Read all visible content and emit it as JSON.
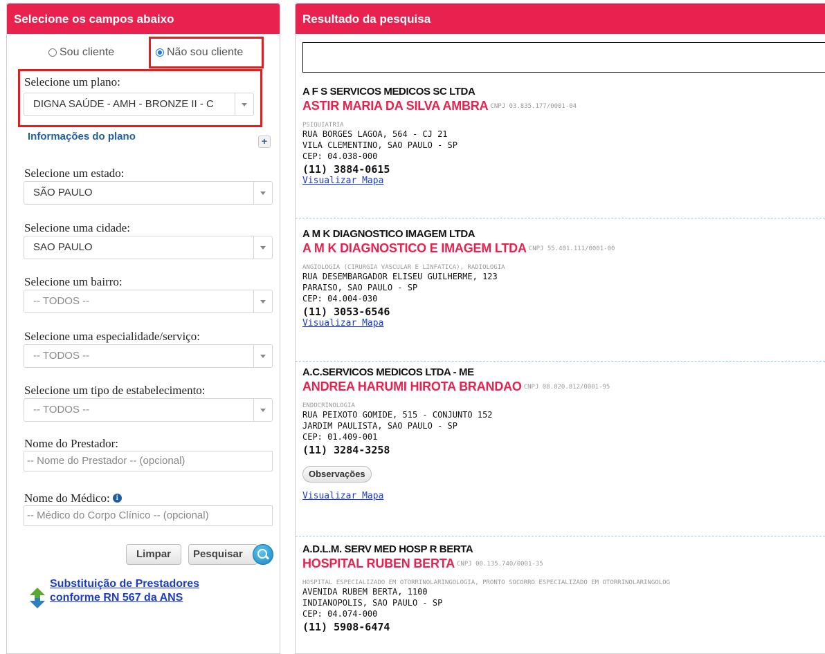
{
  "left_panel": {
    "title": "Selecione os campos abaixo",
    "radio_client": "Sou cliente",
    "radio_not_client": "Não sou cliente",
    "plan_label": "Selecione um plano:",
    "plan_value": "DIGNA SAÚDE - AMH - BRONZE II - C",
    "plan_info_link": "Informações do plano",
    "state_label": "Selecione um estado:",
    "state_value": "SÃO PAULO",
    "city_label": "Selecione uma cidade:",
    "city_value": "SAO PAULO",
    "district_label": "Selecione um bairro:",
    "district_value": "-- TODOS --",
    "specialty_label": "Selecione uma especialidade/serviço:",
    "specialty_value": "-- TODOS --",
    "estab_label": "Selecione um tipo de estabelecimento:",
    "estab_value": "-- TODOS --",
    "provider_label": "Nome do Prestador:",
    "provider_placeholder": "-- Nome do Prestador -- (opcional)",
    "doctor_label": "Nome do Médico:",
    "doctor_placeholder": "-- Médico do Corpo Clínico -- (opcional)",
    "clear_button": "Limpar",
    "search_button": "Pesquisar",
    "subst_link_line1": "Substituição de Prestadores",
    "subst_link_line2": "conforme RN 567 da ANS"
  },
  "right_panel": {
    "title": "Resultado da pesquisa",
    "results": [
      {
        "name": "A F S SERVICOS MEDICOS SC LTDA",
        "subname": "ASTIR MARIA DA SILVA AMBRA",
        "cnpj": "CNPJ 03.835.177/0001-04",
        "specialty": "PSIQUIATRIA",
        "address1": "RUA BORGES LAGOA, 564 - CJ 21",
        "address2": "VILA CLEMENTINO, SAO PAULO - SP",
        "cep": "CEP: 04.038-000",
        "phone": "(11) 3884-0615",
        "map_link": "Visualizar Mapa"
      },
      {
        "name": "A M K DIAGNOSTICO IMAGEM LTDA",
        "subname": "A M K DIAGNOSTICO E IMAGEM LTDA",
        "cnpj": "CNPJ 55.401.111/0001-00",
        "specialty": "ANGIOLOGIA (CIRURGIA VASCULAR E LINFATICA), RADIOLOGIA",
        "address1": "RUA DESEMBARGADOR ELISEU GUILHERME, 123",
        "address2": "PARAISO, SAO PAULO - SP",
        "cep": "CEP: 04.004-030",
        "phone": "(11) 3053-6546",
        "map_link": "Visualizar Mapa"
      },
      {
        "name": "A.C.SERVICOS MEDICOS LTDA - ME",
        "subname": "ANDREA HARUMI HIROTA BRANDAO",
        "cnpj": "CNPJ 08.820.812/0001-95",
        "specialty": "ENDOCRINOLOGIA",
        "address1": "RUA PEIXOTO GOMIDE, 515 - CONJUNTO 152",
        "address2": "JARDIM PAULISTA, SAO PAULO - SP",
        "cep": "CEP: 01.409-001",
        "phone": "(11) 3284-3258",
        "obs_button": "Observações",
        "map_link": "Visualizar Mapa"
      },
      {
        "name": "A.D.L.M. SERV MED HOSP R BERTA",
        "subname": "HOSPITAL RUBEN BERTA",
        "cnpj": "CNPJ 00.135.740/0001-35",
        "specialty": "HOSPITAL ESPECIALIZADO EM OTORRINOLARINGOLOGIA, PRONTO SOCORRO ESPECIALIZADO EM OTORRINOLARINGOLOG",
        "address1": "AVENIDA RUBEM BERTA, 1100",
        "address2": "INDIANOPOLIS, SAO PAULO - SP",
        "cep": "CEP: 04.074-000",
        "phone": "(11) 5908-6474"
      }
    ]
  },
  "colors": {
    "header_bg": "#e8214e",
    "highlight_border": "#e02020",
    "link_blue": "#1a3cc9"
  }
}
